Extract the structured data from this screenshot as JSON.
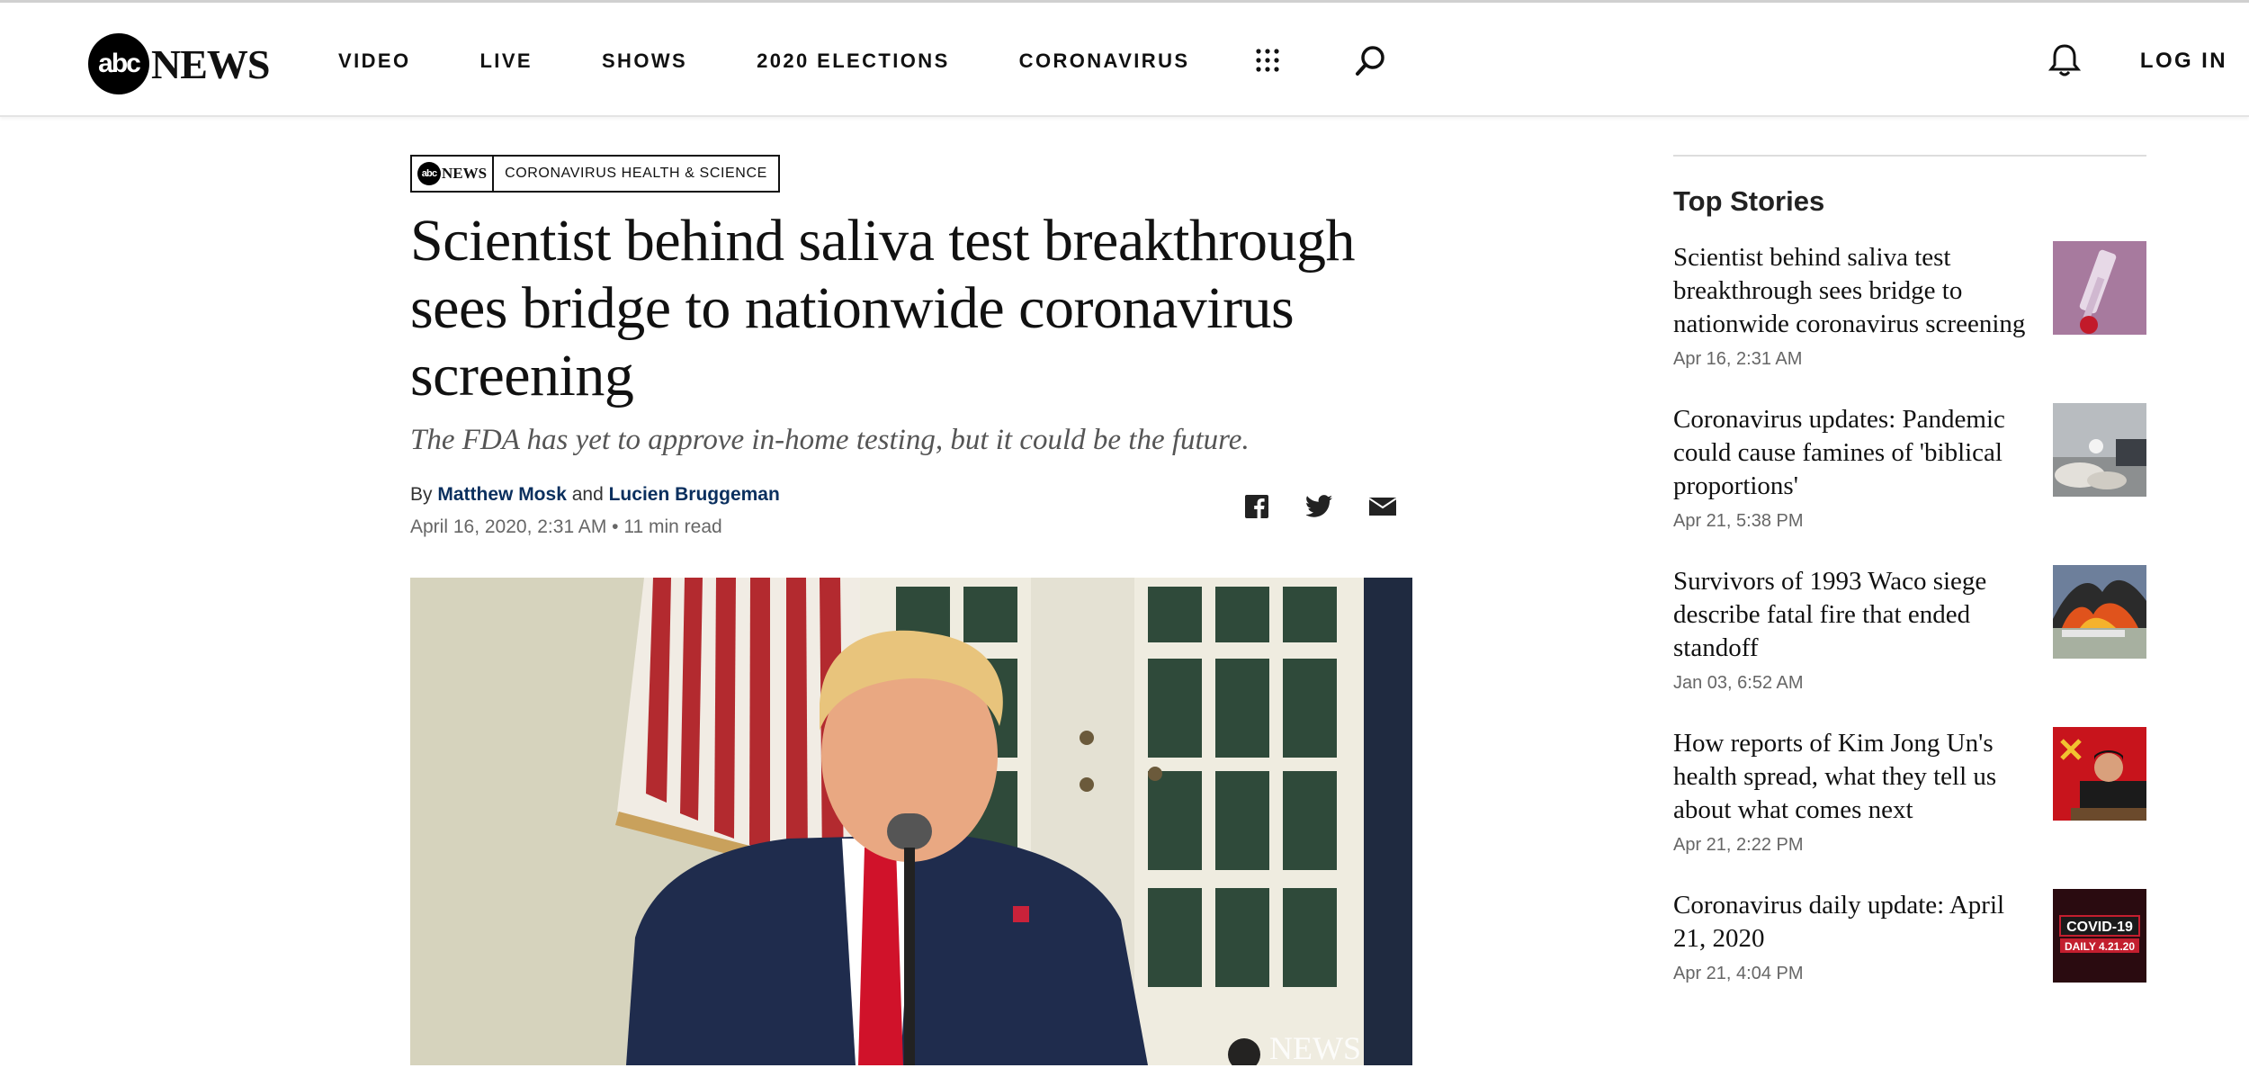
{
  "header": {
    "logo_text": "abc",
    "logo_word": "NEWS",
    "nav": [
      "VIDEO",
      "LIVE",
      "SHOWS",
      "2020 ELECTIONS",
      "CORONAVIRUS"
    ],
    "login_label": "LOG IN",
    "icons": [
      "apps-grid-icon",
      "search-icon",
      "bell-icon"
    ]
  },
  "article": {
    "section_logo_text": "abc",
    "section_logo_word": "NEWS",
    "section_label": "CORONAVIRUS HEALTH & SCIENCE",
    "headline": "Scientist behind saliva test breakthrough sees bridge to nationwide coronavirus screening",
    "dek": "The FDA has yet to approve in-home testing, but it could be the future.",
    "by_label": "By",
    "author1": "Matthew Mosk",
    "and_label": "and",
    "author2": "Lucien Bruggeman",
    "date": "April 16, 2020, 2:31 AM",
    "read_time": "• 11 min read",
    "share_icons": [
      "facebook-icon",
      "twitter-icon",
      "email-icon"
    ],
    "hero_watermark": "NEWS"
  },
  "sidebar": {
    "title": "Top Stories",
    "stories": [
      {
        "title": "Scientist behind saliva test breakthrough sees bridge to nationwide coronavirus screening",
        "date": "Apr 16, 2:31 AM"
      },
      {
        "title": "Coronavirus updates: Pandemic could cause famines of 'biblical proportions'",
        "date": "Apr 21, 5:38 PM"
      },
      {
        "title": "Survivors of 1993 Waco siege describe fatal fire that ended standoff",
        "date": "Jan 03, 6:52 AM"
      },
      {
        "title": "How reports of Kim Jong Un's health spread, what they tell us about what comes next",
        "date": "Apr 21, 2:22 PM"
      },
      {
        "title": "Coronavirus daily update: April 21, 2020",
        "date": "Apr 21, 4:04 PM",
        "thumb_line1": "COVID-19",
        "thumb_line2": "DAILY 4.21.20"
      }
    ]
  },
  "colors": {
    "author_link": "#0a2f5e",
    "text": "#111111",
    "muted": "#666666"
  }
}
